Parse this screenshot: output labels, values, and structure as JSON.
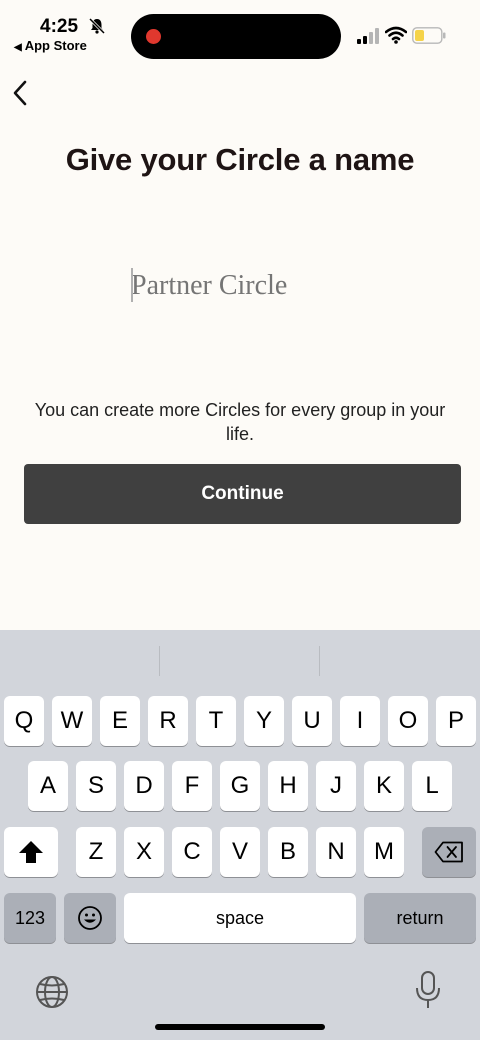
{
  "status_bar": {
    "time": "4:25",
    "back_app_label": "App Store",
    "recording_color": "#e0382e",
    "battery_color": "#f5d349"
  },
  "page": {
    "title": "Give your Circle a name",
    "name_placeholder": "Partner Circle",
    "name_value": "",
    "hint": "You can create more Circles for every group in your life.",
    "continue_label": "Continue"
  },
  "keyboard": {
    "row1": [
      "Q",
      "W",
      "E",
      "R",
      "T",
      "Y",
      "U",
      "I",
      "O",
      "P"
    ],
    "row2": [
      "A",
      "S",
      "D",
      "F",
      "G",
      "H",
      "J",
      "K",
      "L"
    ],
    "row3": [
      "Z",
      "X",
      "C",
      "V",
      "B",
      "N",
      "M"
    ],
    "numbers_label": "123",
    "space_label": "space",
    "return_label": "return",
    "icons": {
      "shift": "shift-icon",
      "delete": "backspace-icon",
      "emoji": "emoji-icon",
      "globe": "globe-icon",
      "mic": "microphone-icon"
    }
  }
}
